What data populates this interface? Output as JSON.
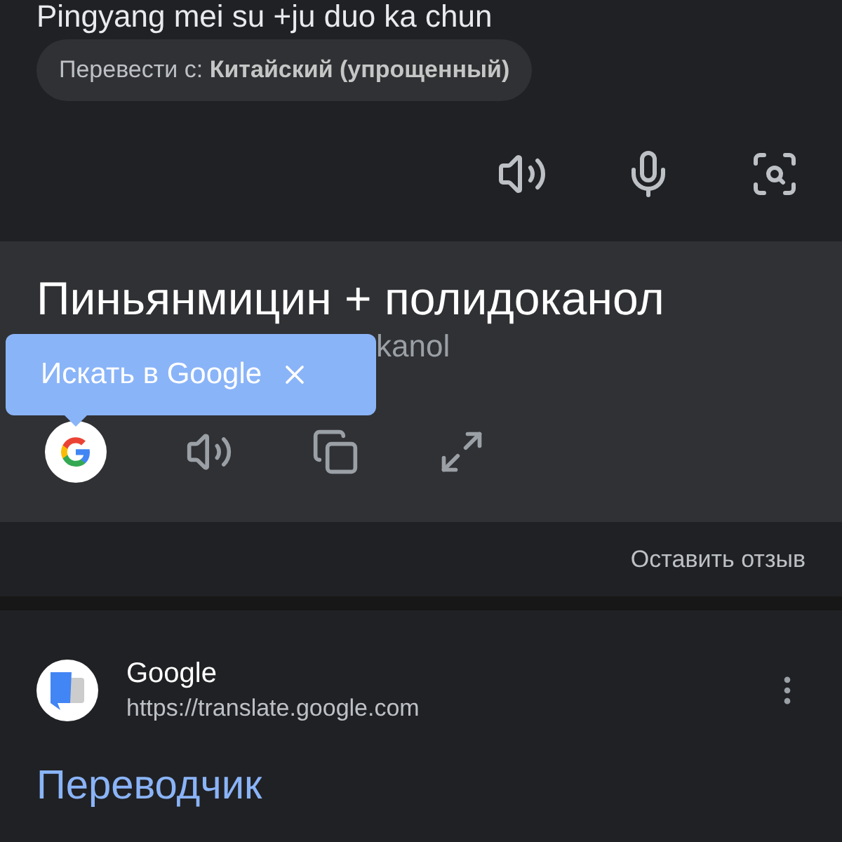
{
  "source": {
    "text": "Pingyang mei su +ju duo ka chun",
    "translate_from": {
      "label": "Перевести с:",
      "language": "Китайский (упрощенный)"
    }
  },
  "result": {
    "text": "Пиньянмицин + полидоканол",
    "transliteration": "kanol",
    "tooltip": {
      "label": "Искать в Google"
    }
  },
  "feedback": "Оставить отзыв",
  "search_result": {
    "site": "Google",
    "url": "https://translate.google.com",
    "title": "Переводчик"
  }
}
